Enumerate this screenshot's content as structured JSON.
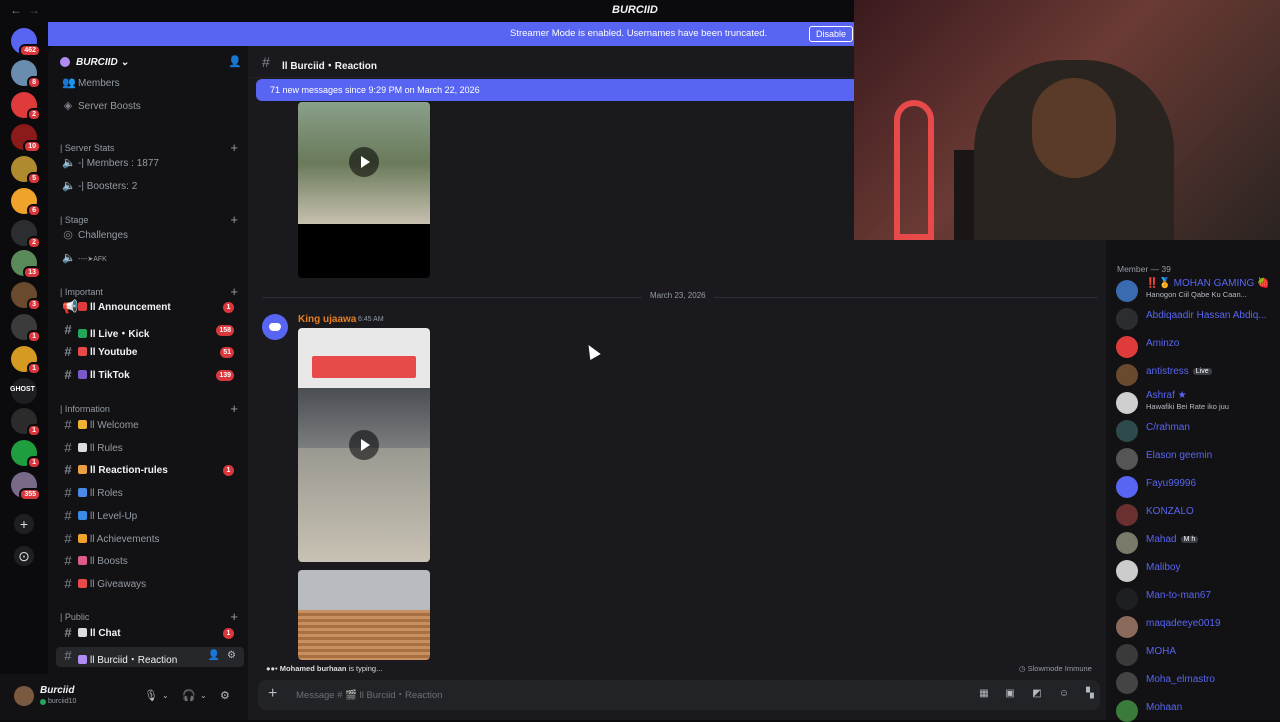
{
  "window": {
    "title": "BURCIID"
  },
  "colors": {
    "accent": "#5865f2",
    "danger": "#da373c",
    "online": "#23a55a",
    "author": "#e67e22"
  },
  "rail": {
    "servers": [
      {
        "name": "direct-messages",
        "badge": "462",
        "color": "#5865f2"
      },
      {
        "name": "server-2",
        "badge": "8",
        "color": "#6a8caf"
      },
      {
        "name": "server-3",
        "badge": "2",
        "color": "#e03b3b"
      },
      {
        "name": "server-4",
        "badge": "10",
        "color": "#8b1a1a"
      },
      {
        "name": "server-5",
        "badge": "5",
        "color": "#b08a2e"
      },
      {
        "name": "server-6",
        "badge": "6",
        "color": "#f0a32a"
      },
      {
        "name": "server-7",
        "badge": "2",
        "color": "#2b2d31"
      },
      {
        "name": "server-8",
        "badge": "13",
        "color": "#5a8a5a"
      },
      {
        "name": "server-9",
        "badge": "3",
        "color": "#6a4a2e"
      },
      {
        "name": "server-10",
        "badge": "1",
        "color": "#3b3b3b"
      },
      {
        "name": "server-11",
        "badge": "1",
        "color": "#d49a22"
      },
      {
        "name": "server-12",
        "badge": "",
        "color": "#1e1f22"
      },
      {
        "name": "server-13",
        "badge": "1",
        "color": "#2b2b2b"
      },
      {
        "name": "server-14",
        "badge": "1",
        "color": "#1e9e3e"
      },
      {
        "name": "server-15",
        "badge": "355",
        "color": "#7a6a8a"
      }
    ],
    "ghost_label": "GHOST"
  },
  "streamer_banner": {
    "message": "Streamer Mode is enabled. Usernames have been truncated.",
    "button": "Disable"
  },
  "sidebar": {
    "server_name": "BURCIID",
    "items": [
      {
        "label": "Members",
        "icon": "members-icon",
        "glyph": "👥"
      },
      {
        "label": "Server Boosts",
        "icon": "boost-icon",
        "glyph": "◈"
      }
    ],
    "categories": {
      "server_stats": "| Server Stats",
      "stage": "| Stage",
      "important": "| Important",
      "information": "| Information",
      "public": "| Public"
    },
    "stats": {
      "members": "-| Members : 1877",
      "boosters": "-| Boosters: 2"
    },
    "stage_items": {
      "challenges": "Challenges",
      "afk": "----➤AFK"
    },
    "important": [
      {
        "label": "ll Announcement",
        "count": "1"
      },
      {
        "label": "ll Live・Kick",
        "count": "158"
      },
      {
        "label": "ll Youtube",
        "count": "51"
      },
      {
        "label": "ll TikTok",
        "count": "139"
      }
    ],
    "information": [
      {
        "label": "ll Welcome",
        "count": ""
      },
      {
        "label": "ll Rules",
        "count": ""
      },
      {
        "label": "ll Reaction-rules",
        "count": "1"
      },
      {
        "label": "ll Roles",
        "count": ""
      },
      {
        "label": "ll Level-Up",
        "count": ""
      },
      {
        "label": "ll Achievements",
        "count": ""
      },
      {
        "label": "ll Boosts",
        "count": ""
      },
      {
        "label": "ll Giveaways",
        "count": ""
      }
    ],
    "public": [
      {
        "label": "ll Chat",
        "count": "1"
      },
      {
        "label": "ll Burciid・Reaction",
        "count": ""
      }
    ]
  },
  "user_panel": {
    "username": "Burciid",
    "status": "burciid10"
  },
  "channel": {
    "title": "ll Burciid・Reaction",
    "new_messages": "71 new messages since 9:29 PM on March 22, 2026",
    "date_divider": "March 23, 2026",
    "message": {
      "author": "King ujaawa",
      "time": "6:45 AM"
    },
    "typing_user": "Mohamed burhaan",
    "typing_suffix": " is typing...",
    "slowmode": "Slowmode Immune",
    "composer_placeholder": "Message # 🎬 ll Burciid・Reaction"
  },
  "members": {
    "header": "Member — 39",
    "list": [
      {
        "name": "‼️🏅 MOHAN GAMING 🍓",
        "sub": "Hanogon Ciil Qabe Ku Caan...",
        "color": "#3a6ab0",
        "tag": ""
      },
      {
        "name": "Abdiqaadir Hassan Abdiq...",
        "sub": "",
        "color": "#2b2d31",
        "tag": ""
      },
      {
        "name": "Aminzo",
        "sub": "",
        "color": "#e03b3b",
        "tag": ""
      },
      {
        "name": "antistress",
        "sub": "",
        "color": "#6a4a2e",
        "tag": "Live"
      },
      {
        "name": "Ashraf ★",
        "sub": "Hawafiki Bei Rate iko juu",
        "color": "#cfcfcf",
        "tag": ""
      },
      {
        "name": "C/rahman",
        "sub": "",
        "color": "#2e4a4a",
        "tag": ""
      },
      {
        "name": "Elason geemin",
        "sub": "",
        "color": "#555555",
        "tag": ""
      },
      {
        "name": "Fayu99996",
        "sub": "",
        "color": "#5865f2",
        "tag": ""
      },
      {
        "name": "KONZALO",
        "sub": "",
        "color": "#6a3030",
        "tag": ""
      },
      {
        "name": "Mahad",
        "sub": "",
        "color": "#7a7a6a",
        "tag": "M h"
      },
      {
        "name": "Maliboy",
        "sub": "",
        "color": "#cccccc",
        "tag": ""
      },
      {
        "name": "Man-to-man67",
        "sub": "",
        "color": "#1e1f22",
        "tag": ""
      },
      {
        "name": "maqadeeye0019",
        "sub": "",
        "color": "#8a6a5a",
        "tag": ""
      },
      {
        "name": "MOHA",
        "sub": "",
        "color": "#3a3a3a",
        "tag": ""
      },
      {
        "name": "Moha_elmastro",
        "sub": "",
        "color": "#444444",
        "tag": ""
      },
      {
        "name": "Mohaan",
        "sub": "",
        "color": "#3a7a3a",
        "tag": ""
      }
    ]
  }
}
